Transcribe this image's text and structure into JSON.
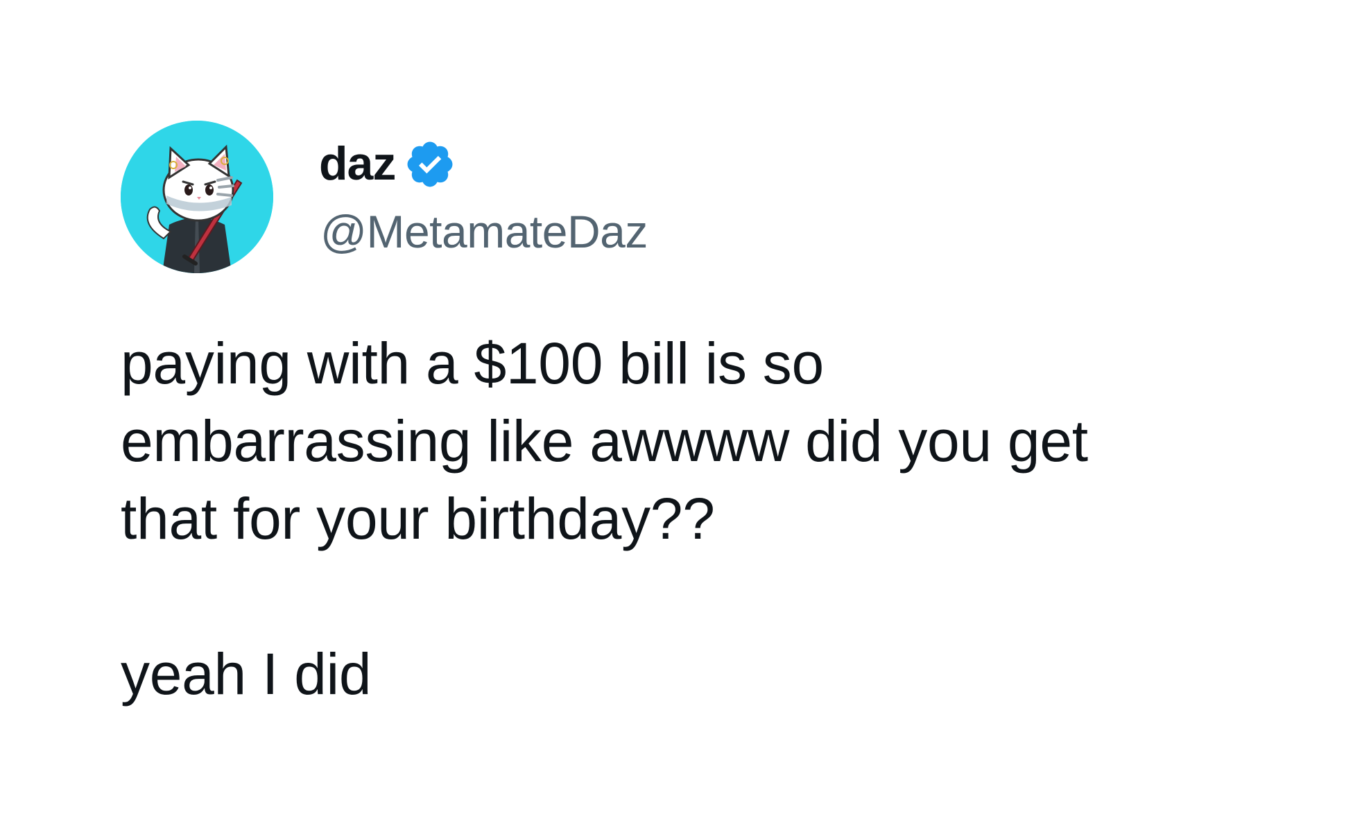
{
  "author": {
    "display_name": "daz",
    "handle": "@MetamateDaz",
    "verified": true,
    "avatar_icon": "cat-with-sword-avatar-icon",
    "avatar_bg_color": "#2fd6e8",
    "verified_icon": "verified-badge-icon",
    "verified_color": "#1d9bf0"
  },
  "tweet": {
    "paragraph_1": "paying with a $100 bill is so\nembarrassing like awwww did you get\nthat for your birthday??",
    "paragraph_2": "yeah I did"
  },
  "colors": {
    "text": "#0f1419",
    "secondary_text": "#536471",
    "background": "#ffffff"
  }
}
